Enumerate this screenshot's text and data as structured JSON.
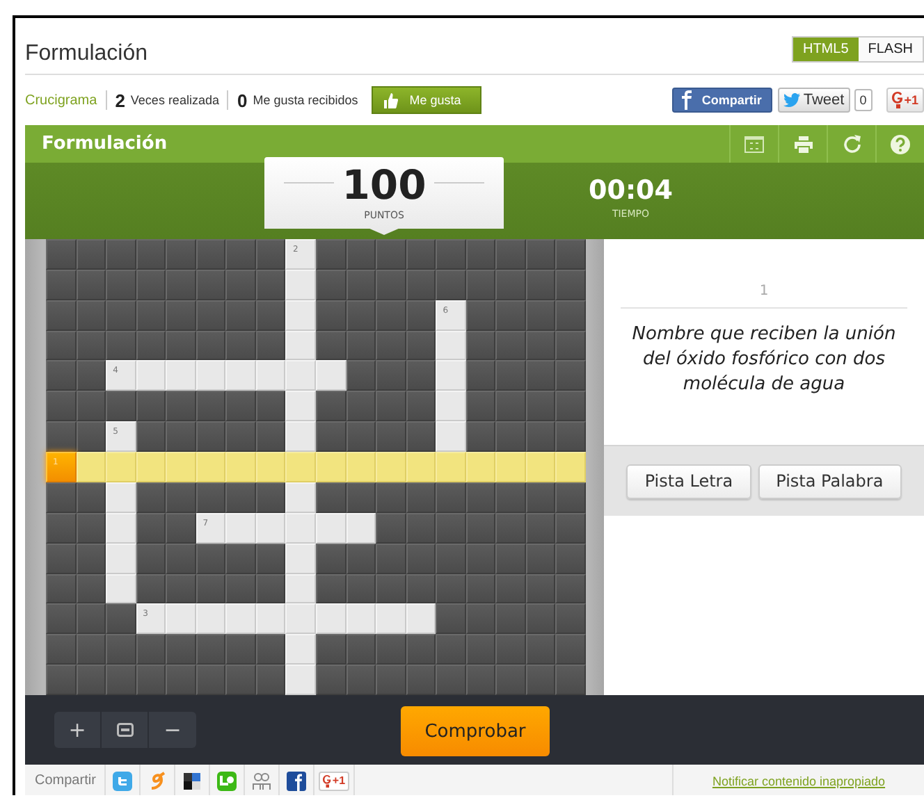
{
  "page_title": "Formulación",
  "modes": [
    {
      "label": "HTML5",
      "selected": true
    },
    {
      "label": "FLASH",
      "selected": false
    }
  ],
  "stats": {
    "category": "Crucigrama",
    "plays_count": "2",
    "plays_label": "Veces realizada",
    "likes_count": "0",
    "likes_label": "Me gusta recibidos",
    "like_button": "Me gusta"
  },
  "social": {
    "facebook": "Compartir",
    "tweet": "Tweet",
    "tweet_count": "0",
    "gplus": "+1"
  },
  "game": {
    "title": "Formulación",
    "score": {
      "value": "100",
      "label": "PUNTOS"
    },
    "time": {
      "value": "00:04",
      "label": "TIEMPO"
    },
    "grid": {
      "rows": [
        [
          {
            "kind": "block"
          },
          {
            "kind": "block"
          },
          {
            "kind": "block"
          },
          {
            "kind": "block"
          },
          {
            "kind": "block"
          },
          {
            "kind": "block"
          },
          {
            "kind": "block"
          },
          {
            "kind": "block"
          },
          {
            "kind": "open",
            "number": "2"
          },
          {
            "kind": "block"
          },
          {
            "kind": "block"
          },
          {
            "kind": "block"
          },
          {
            "kind": "block"
          },
          {
            "kind": "block"
          },
          {
            "kind": "block"
          },
          {
            "kind": "block"
          },
          {
            "kind": "block"
          },
          {
            "kind": "block"
          }
        ],
        [
          {
            "kind": "block"
          },
          {
            "kind": "block"
          },
          {
            "kind": "block"
          },
          {
            "kind": "block"
          },
          {
            "kind": "block"
          },
          {
            "kind": "block"
          },
          {
            "kind": "block"
          },
          {
            "kind": "block"
          },
          {
            "kind": "open"
          },
          {
            "kind": "block"
          },
          {
            "kind": "block"
          },
          {
            "kind": "block"
          },
          {
            "kind": "block"
          },
          {
            "kind": "block"
          },
          {
            "kind": "block"
          },
          {
            "kind": "block"
          },
          {
            "kind": "block"
          },
          {
            "kind": "block"
          }
        ],
        [
          {
            "kind": "block"
          },
          {
            "kind": "block"
          },
          {
            "kind": "block"
          },
          {
            "kind": "block"
          },
          {
            "kind": "block"
          },
          {
            "kind": "block"
          },
          {
            "kind": "block"
          },
          {
            "kind": "block"
          },
          {
            "kind": "open"
          },
          {
            "kind": "block"
          },
          {
            "kind": "block"
          },
          {
            "kind": "block"
          },
          {
            "kind": "block"
          },
          {
            "kind": "open",
            "number": "6"
          },
          {
            "kind": "block"
          },
          {
            "kind": "block"
          },
          {
            "kind": "block"
          },
          {
            "kind": "block"
          }
        ],
        [
          {
            "kind": "block"
          },
          {
            "kind": "block"
          },
          {
            "kind": "block"
          },
          {
            "kind": "block"
          },
          {
            "kind": "block"
          },
          {
            "kind": "block"
          },
          {
            "kind": "block"
          },
          {
            "kind": "block"
          },
          {
            "kind": "open"
          },
          {
            "kind": "block"
          },
          {
            "kind": "block"
          },
          {
            "kind": "block"
          },
          {
            "kind": "block"
          },
          {
            "kind": "open"
          },
          {
            "kind": "block"
          },
          {
            "kind": "block"
          },
          {
            "kind": "block"
          },
          {
            "kind": "block"
          }
        ],
        [
          {
            "kind": "block"
          },
          {
            "kind": "block"
          },
          {
            "kind": "open",
            "number": "4"
          },
          {
            "kind": "open"
          },
          {
            "kind": "open"
          },
          {
            "kind": "open"
          },
          {
            "kind": "open"
          },
          {
            "kind": "open"
          },
          {
            "kind": "open"
          },
          {
            "kind": "open"
          },
          {
            "kind": "block"
          },
          {
            "kind": "block"
          },
          {
            "kind": "block"
          },
          {
            "kind": "open"
          },
          {
            "kind": "block"
          },
          {
            "kind": "block"
          },
          {
            "kind": "block"
          },
          {
            "kind": "block"
          }
        ],
        [
          {
            "kind": "block"
          },
          {
            "kind": "block"
          },
          {
            "kind": "block"
          },
          {
            "kind": "block"
          },
          {
            "kind": "block"
          },
          {
            "kind": "block"
          },
          {
            "kind": "block"
          },
          {
            "kind": "block"
          },
          {
            "kind": "open"
          },
          {
            "kind": "block"
          },
          {
            "kind": "block"
          },
          {
            "kind": "block"
          },
          {
            "kind": "block"
          },
          {
            "kind": "open"
          },
          {
            "kind": "block"
          },
          {
            "kind": "block"
          },
          {
            "kind": "block"
          },
          {
            "kind": "block"
          }
        ],
        [
          {
            "kind": "block"
          },
          {
            "kind": "block"
          },
          {
            "kind": "open",
            "number": "5"
          },
          {
            "kind": "block"
          },
          {
            "kind": "block"
          },
          {
            "kind": "block"
          },
          {
            "kind": "block"
          },
          {
            "kind": "block"
          },
          {
            "kind": "open"
          },
          {
            "kind": "block"
          },
          {
            "kind": "block"
          },
          {
            "kind": "block"
          },
          {
            "kind": "block"
          },
          {
            "kind": "open"
          },
          {
            "kind": "block"
          },
          {
            "kind": "block"
          },
          {
            "kind": "block"
          },
          {
            "kind": "block"
          }
        ],
        [
          {
            "kind": "active",
            "number": "1"
          },
          {
            "kind": "highlighted"
          },
          {
            "kind": "highlighted"
          },
          {
            "kind": "highlighted"
          },
          {
            "kind": "highlighted"
          },
          {
            "kind": "highlighted"
          },
          {
            "kind": "highlighted"
          },
          {
            "kind": "highlighted"
          },
          {
            "kind": "highlighted"
          },
          {
            "kind": "highlighted"
          },
          {
            "kind": "highlighted"
          },
          {
            "kind": "highlighted"
          },
          {
            "kind": "highlighted"
          },
          {
            "kind": "highlighted"
          },
          {
            "kind": "highlighted"
          },
          {
            "kind": "highlighted"
          },
          {
            "kind": "highlighted"
          },
          {
            "kind": "highlighted"
          }
        ],
        [
          {
            "kind": "block"
          },
          {
            "kind": "block"
          },
          {
            "kind": "open"
          },
          {
            "kind": "block"
          },
          {
            "kind": "block"
          },
          {
            "kind": "block"
          },
          {
            "kind": "block"
          },
          {
            "kind": "block"
          },
          {
            "kind": "open"
          },
          {
            "kind": "block"
          },
          {
            "kind": "block"
          },
          {
            "kind": "block"
          },
          {
            "kind": "block"
          },
          {
            "kind": "block"
          },
          {
            "kind": "block"
          },
          {
            "kind": "block"
          },
          {
            "kind": "block"
          },
          {
            "kind": "block"
          }
        ],
        [
          {
            "kind": "block"
          },
          {
            "kind": "block"
          },
          {
            "kind": "open"
          },
          {
            "kind": "block"
          },
          {
            "kind": "block"
          },
          {
            "kind": "open",
            "number": "7"
          },
          {
            "kind": "open"
          },
          {
            "kind": "open"
          },
          {
            "kind": "open"
          },
          {
            "kind": "open"
          },
          {
            "kind": "open"
          },
          {
            "kind": "block"
          },
          {
            "kind": "block"
          },
          {
            "kind": "block"
          },
          {
            "kind": "block"
          },
          {
            "kind": "block"
          },
          {
            "kind": "block"
          },
          {
            "kind": "block"
          }
        ],
        [
          {
            "kind": "block"
          },
          {
            "kind": "block"
          },
          {
            "kind": "open"
          },
          {
            "kind": "block"
          },
          {
            "kind": "block"
          },
          {
            "kind": "block"
          },
          {
            "kind": "block"
          },
          {
            "kind": "block"
          },
          {
            "kind": "open"
          },
          {
            "kind": "block"
          },
          {
            "kind": "block"
          },
          {
            "kind": "block"
          },
          {
            "kind": "block"
          },
          {
            "kind": "block"
          },
          {
            "kind": "block"
          },
          {
            "kind": "block"
          },
          {
            "kind": "block"
          },
          {
            "kind": "block"
          }
        ],
        [
          {
            "kind": "block"
          },
          {
            "kind": "block"
          },
          {
            "kind": "open"
          },
          {
            "kind": "block"
          },
          {
            "kind": "block"
          },
          {
            "kind": "block"
          },
          {
            "kind": "block"
          },
          {
            "kind": "block"
          },
          {
            "kind": "open"
          },
          {
            "kind": "block"
          },
          {
            "kind": "block"
          },
          {
            "kind": "block"
          },
          {
            "kind": "block"
          },
          {
            "kind": "block"
          },
          {
            "kind": "block"
          },
          {
            "kind": "block"
          },
          {
            "kind": "block"
          },
          {
            "kind": "block"
          }
        ],
        [
          {
            "kind": "block"
          },
          {
            "kind": "block"
          },
          {
            "kind": "block"
          },
          {
            "kind": "open",
            "number": "3"
          },
          {
            "kind": "open"
          },
          {
            "kind": "open"
          },
          {
            "kind": "open"
          },
          {
            "kind": "open"
          },
          {
            "kind": "open"
          },
          {
            "kind": "open"
          },
          {
            "kind": "open"
          },
          {
            "kind": "open"
          },
          {
            "kind": "open"
          },
          {
            "kind": "block"
          },
          {
            "kind": "block"
          },
          {
            "kind": "block"
          },
          {
            "kind": "block"
          },
          {
            "kind": "block"
          }
        ],
        [
          {
            "kind": "block"
          },
          {
            "kind": "block"
          },
          {
            "kind": "block"
          },
          {
            "kind": "block"
          },
          {
            "kind": "block"
          },
          {
            "kind": "block"
          },
          {
            "kind": "block"
          },
          {
            "kind": "block"
          },
          {
            "kind": "open"
          },
          {
            "kind": "block"
          },
          {
            "kind": "block"
          },
          {
            "kind": "block"
          },
          {
            "kind": "block"
          },
          {
            "kind": "block"
          },
          {
            "kind": "block"
          },
          {
            "kind": "block"
          },
          {
            "kind": "block"
          },
          {
            "kind": "block"
          }
        ],
        [
          {
            "kind": "block"
          },
          {
            "kind": "block"
          },
          {
            "kind": "block"
          },
          {
            "kind": "block"
          },
          {
            "kind": "block"
          },
          {
            "kind": "block"
          },
          {
            "kind": "block"
          },
          {
            "kind": "block"
          },
          {
            "kind": "open"
          },
          {
            "kind": "block"
          },
          {
            "kind": "block"
          },
          {
            "kind": "block"
          },
          {
            "kind": "block"
          },
          {
            "kind": "block"
          },
          {
            "kind": "block"
          },
          {
            "kind": "block"
          },
          {
            "kind": "block"
          },
          {
            "kind": "block"
          }
        ]
      ]
    },
    "clue": {
      "number": "1",
      "text": "Nombre que reciben la unión del óxido fosfórico con dos molécula de agua"
    },
    "hint_buttons": [
      "Pista Letra",
      "Pista Palabra"
    ],
    "zoom_controls": [
      "+",
      "−"
    ],
    "check_button": "Comprobar"
  },
  "footer": {
    "share_label": "Compartir",
    "gplus": "+1",
    "report_link": "Notificar contenido inapropiado"
  }
}
